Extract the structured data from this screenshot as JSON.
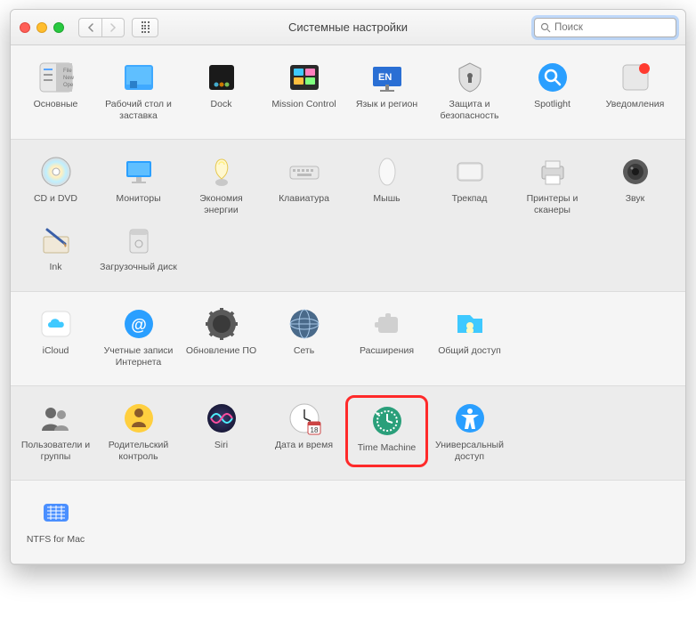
{
  "window": {
    "title": "Системные настройки"
  },
  "search": {
    "placeholder": "Поиск"
  },
  "sections": [
    {
      "alt": false,
      "items": [
        {
          "id": "general",
          "label": "Основные"
        },
        {
          "id": "desktop",
          "label": "Рабочий стол и заставка"
        },
        {
          "id": "dock",
          "label": "Dock"
        },
        {
          "id": "mission",
          "label": "Mission Control"
        },
        {
          "id": "language",
          "label": "Язык и регион"
        },
        {
          "id": "security",
          "label": "Защита и безопасность"
        },
        {
          "id": "spotlight",
          "label": "Spotlight"
        },
        {
          "id": "notifications",
          "label": "Уведомления"
        }
      ]
    },
    {
      "alt": true,
      "items": [
        {
          "id": "cddvd",
          "label": "CD и DVD"
        },
        {
          "id": "displays",
          "label": "Мониторы"
        },
        {
          "id": "energy",
          "label": "Экономия энергии"
        },
        {
          "id": "keyboard",
          "label": "Клавиатура"
        },
        {
          "id": "mouse",
          "label": "Мышь"
        },
        {
          "id": "trackpad",
          "label": "Трекпад"
        },
        {
          "id": "printers",
          "label": "Принтеры и сканеры"
        },
        {
          "id": "sound",
          "label": "Звук"
        },
        {
          "id": "ink",
          "label": "Ink"
        },
        {
          "id": "startup",
          "label": "Загрузочный диск"
        }
      ]
    },
    {
      "alt": false,
      "items": [
        {
          "id": "icloud",
          "label": "iCloud"
        },
        {
          "id": "accounts",
          "label": "Учетные записи Интернета"
        },
        {
          "id": "software",
          "label": "Обновление ПО"
        },
        {
          "id": "network",
          "label": "Сеть"
        },
        {
          "id": "extensions",
          "label": "Расширения"
        },
        {
          "id": "sharing",
          "label": "Общий доступ"
        }
      ]
    },
    {
      "alt": true,
      "items": [
        {
          "id": "users",
          "label": "Пользователи и группы"
        },
        {
          "id": "parental",
          "label": "Родительский контроль"
        },
        {
          "id": "siri",
          "label": "Siri"
        },
        {
          "id": "datetime",
          "label": "Дата и время"
        },
        {
          "id": "timemachine",
          "label": "Time Machine",
          "highlight": true
        },
        {
          "id": "accessibility",
          "label": "Универсальный доступ"
        }
      ]
    },
    {
      "alt": false,
      "items": [
        {
          "id": "ntfs",
          "label": "NTFS for Mac"
        }
      ]
    }
  ]
}
